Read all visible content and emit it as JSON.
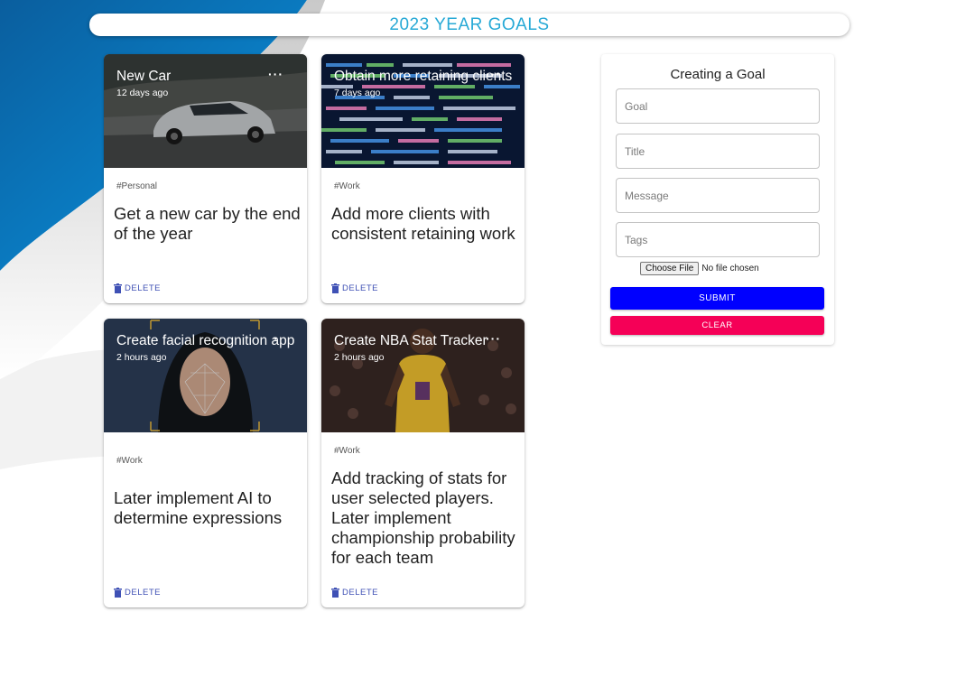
{
  "header": {
    "title": "2023 YEAR GOALS"
  },
  "posts": [
    {
      "title": "New Car",
      "time": "12 days ago",
      "tags": "#Personal",
      "message": "Get a new car by the end of the year",
      "delete_label": "DELETE",
      "more_icon": "more-horiz-icon",
      "image": "car-photo"
    },
    {
      "title": "Obtain more retaining clients",
      "time": "7 days ago",
      "tags": "#Work",
      "message": "Add more clients with consistent retaining work",
      "delete_label": "DELETE",
      "more_icon": "more-horiz-icon",
      "image": "code-screen-photo"
    },
    {
      "title": "Create facial recognition app",
      "time": "2 hours ago",
      "tags": "#Work",
      "message": "Later implement AI to determine expressions",
      "delete_label": "DELETE",
      "more_icon": "more-horiz-icon",
      "image": "face-scan-photo"
    },
    {
      "title": "Create NBA Stat Tracker",
      "time": "2 hours ago",
      "tags": "#Work",
      "message": "Add tracking of stats for user selected players. Later implement championship probability for each team",
      "delete_label": "DELETE",
      "more_icon": "more-horiz-icon",
      "image": "basketball-player-photo"
    }
  ],
  "form": {
    "title": "Creating a Goal",
    "goal_placeholder": "Goal",
    "title_placeholder": "Title",
    "message_placeholder": "Message",
    "tags_placeholder": "Tags",
    "file_button": "Choose File",
    "file_status": "No file chosen",
    "submit_label": "SUBMIT",
    "clear_label": "CLEAR"
  },
  "colors": {
    "header_text": "#27a9d6",
    "submit": "#0000ff",
    "clear": "#f50057",
    "delete_text": "#3f51b5",
    "background_accent": "#0a6fb4"
  }
}
